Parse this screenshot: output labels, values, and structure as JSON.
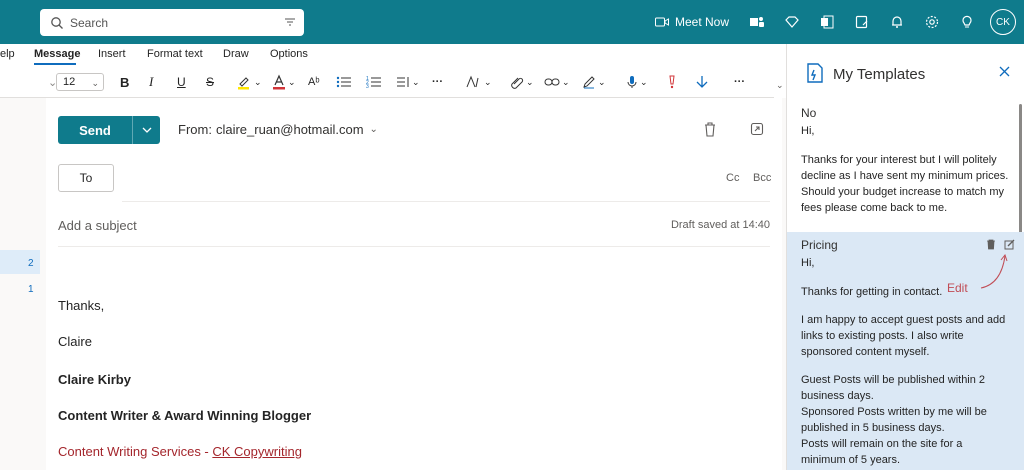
{
  "search": {
    "placeholder": "Search"
  },
  "topbar": {
    "meet_now": "Meet Now",
    "avatar_initials": "CK"
  },
  "ribbon": {
    "tabs": [
      {
        "label": "elp"
      },
      {
        "label": "Message"
      },
      {
        "label": "Insert"
      },
      {
        "label": "Format text"
      },
      {
        "label": "Draw"
      },
      {
        "label": "Options"
      }
    ],
    "font_size": "12"
  },
  "compose": {
    "send_label": "Send",
    "from_label": "From:",
    "from_address": "claire_ruan@hotmail.com",
    "to_label": "To",
    "cc_label": "Cc",
    "bcc_label": "Bcc",
    "subject_placeholder": "Add a subject",
    "draft_status": "Draft saved at 14:40",
    "body": {
      "line1": "Thanks,",
      "line2": "Claire",
      "name": "Claire Kirby",
      "title": "Content Writer & Award Winning Blogger",
      "services_prefix": "Content Writing Services - ",
      "services_link": "CK Copywriting"
    }
  },
  "gutter": {
    "numbers": [
      "2",
      "1"
    ]
  },
  "panel": {
    "title": "My Templates",
    "templates": [
      {
        "name": "No",
        "greeting": "Hi,",
        "lines": [
          "Thanks for your interest but I will politely",
          "decline as I have sent my minimum prices.",
          "Should your budget increase to match my",
          "fees please come back to me."
        ]
      },
      {
        "name": "Pricing",
        "greeting": "Hi,",
        "intro": "Thanks for getting in contact.",
        "para1": [
          "I am happy to accept guest posts and add",
          "links to existing posts. I also write",
          "sponsored content myself."
        ],
        "para2": [
          "Guest Posts will be published within 2",
          "business days.",
          "Sponsored Posts written by me will be",
          "published in 5 business days.",
          "Posts will remain on the site for a",
          "minimum of 5 years."
        ]
      }
    ],
    "annotation": "Edit"
  },
  "colors": {
    "brand": "#0f7b8c",
    "annotation": "#c14c55",
    "selected_bg": "#dbe8f5"
  }
}
